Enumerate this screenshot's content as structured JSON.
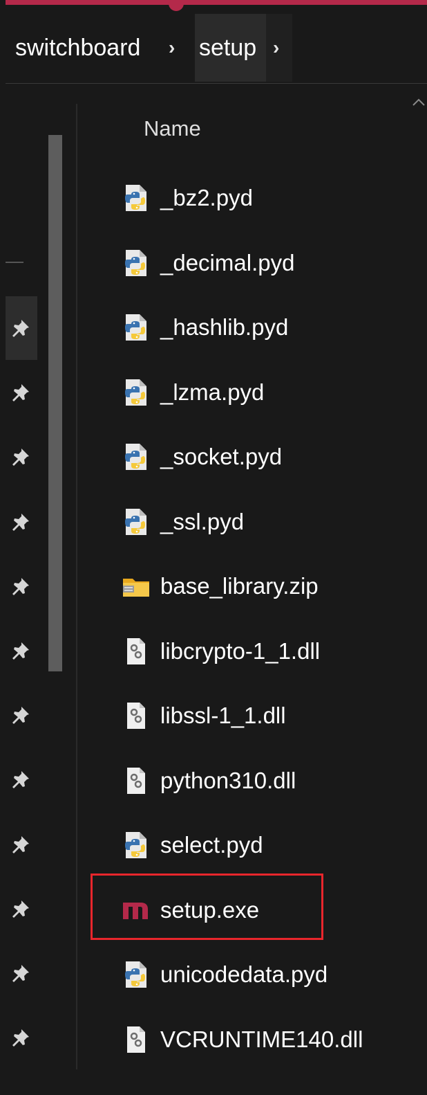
{
  "breadcrumb": {
    "items": [
      {
        "label": "switchboard"
      },
      {
        "label": "setup"
      }
    ],
    "separator": "›"
  },
  "file_list": {
    "column_header": "Name",
    "files": [
      {
        "name": "_bz2.pyd",
        "icon": "python-file-icon"
      },
      {
        "name": "_decimal.pyd",
        "icon": "python-file-icon"
      },
      {
        "name": "_hashlib.pyd",
        "icon": "python-file-icon"
      },
      {
        "name": "_lzma.pyd",
        "icon": "python-file-icon"
      },
      {
        "name": "_socket.pyd",
        "icon": "python-file-icon"
      },
      {
        "name": "_ssl.pyd",
        "icon": "python-file-icon"
      },
      {
        "name": "base_library.zip",
        "icon": "zip-folder-icon"
      },
      {
        "name": "libcrypto-1_1.dll",
        "icon": "dll-file-icon"
      },
      {
        "name": "libssl-1_1.dll",
        "icon": "dll-file-icon"
      },
      {
        "name": "python310.dll",
        "icon": "dll-file-icon"
      },
      {
        "name": "select.pyd",
        "icon": "python-file-icon"
      },
      {
        "name": "setup.exe",
        "icon": "app-exe-icon",
        "highlighted": true
      },
      {
        "name": "unicodedata.pyd",
        "icon": "python-file-icon"
      },
      {
        "name": "VCRUNTIME140.dll",
        "icon": "dll-file-icon"
      }
    ]
  },
  "nav_pane": {
    "pin_icon_count": 12
  },
  "colors": {
    "background": "#191919",
    "text": "#ffffff",
    "accent": "#b4294a",
    "highlight_border": "#e8262c",
    "exe_icon": "#b4294a"
  }
}
